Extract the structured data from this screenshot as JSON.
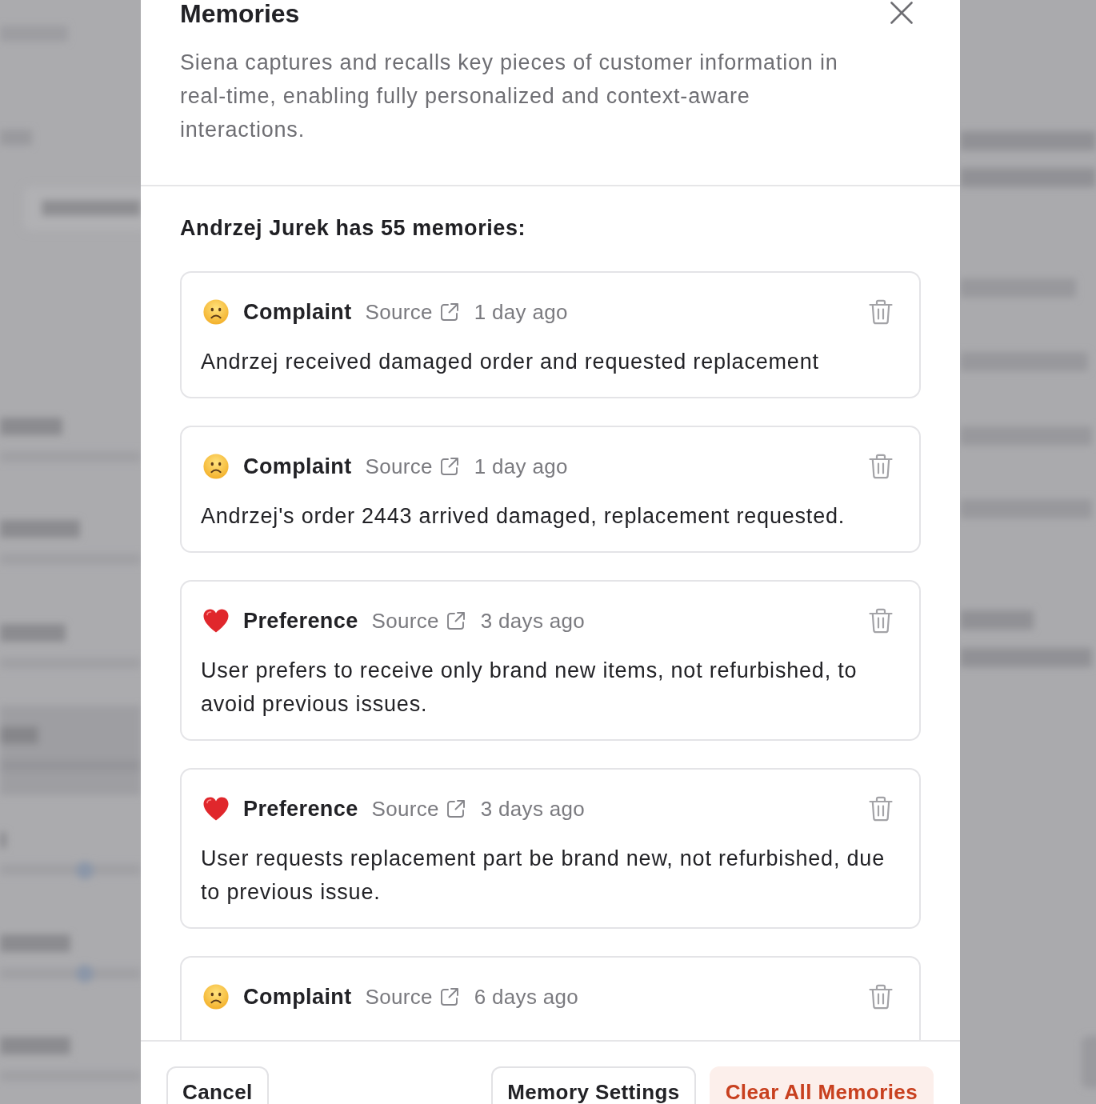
{
  "dialog": {
    "title": "Memories",
    "description": "Siena captures and recalls key pieces of customer information in real-time, enabling fully personalized and context-aware interactions."
  },
  "summary": "Andrzej Jurek has 55 memories:",
  "memories": [
    {
      "kind": "complaint",
      "label": "Complaint",
      "source": "Source",
      "time": "1 day ago",
      "text": "Andrzej received damaged order and requested replacement"
    },
    {
      "kind": "complaint",
      "label": "Complaint",
      "source": "Source",
      "time": "1 day ago",
      "text": "Andrzej's order 2443 arrived damaged, replacement requested."
    },
    {
      "kind": "preference",
      "label": "Preference",
      "source": "Source",
      "time": "3 days ago",
      "text": "User prefers to receive only brand new items, not refurbished, to avoid previous issues."
    },
    {
      "kind": "preference",
      "label": "Preference",
      "source": "Source",
      "time": "3 days ago",
      "text": "User requests replacement part be brand new, not refurbished, due to previous issue."
    },
    {
      "kind": "complaint",
      "label": "Complaint",
      "source": "Source",
      "time": "6 days ago"
    }
  ],
  "footer": {
    "buttons": [
      {
        "label": "Cancel",
        "kind": "secondary"
      },
      {
        "label": "Memory Settings",
        "kind": "secondary"
      },
      {
        "label": "Clear All Memories",
        "kind": "danger"
      }
    ]
  }
}
